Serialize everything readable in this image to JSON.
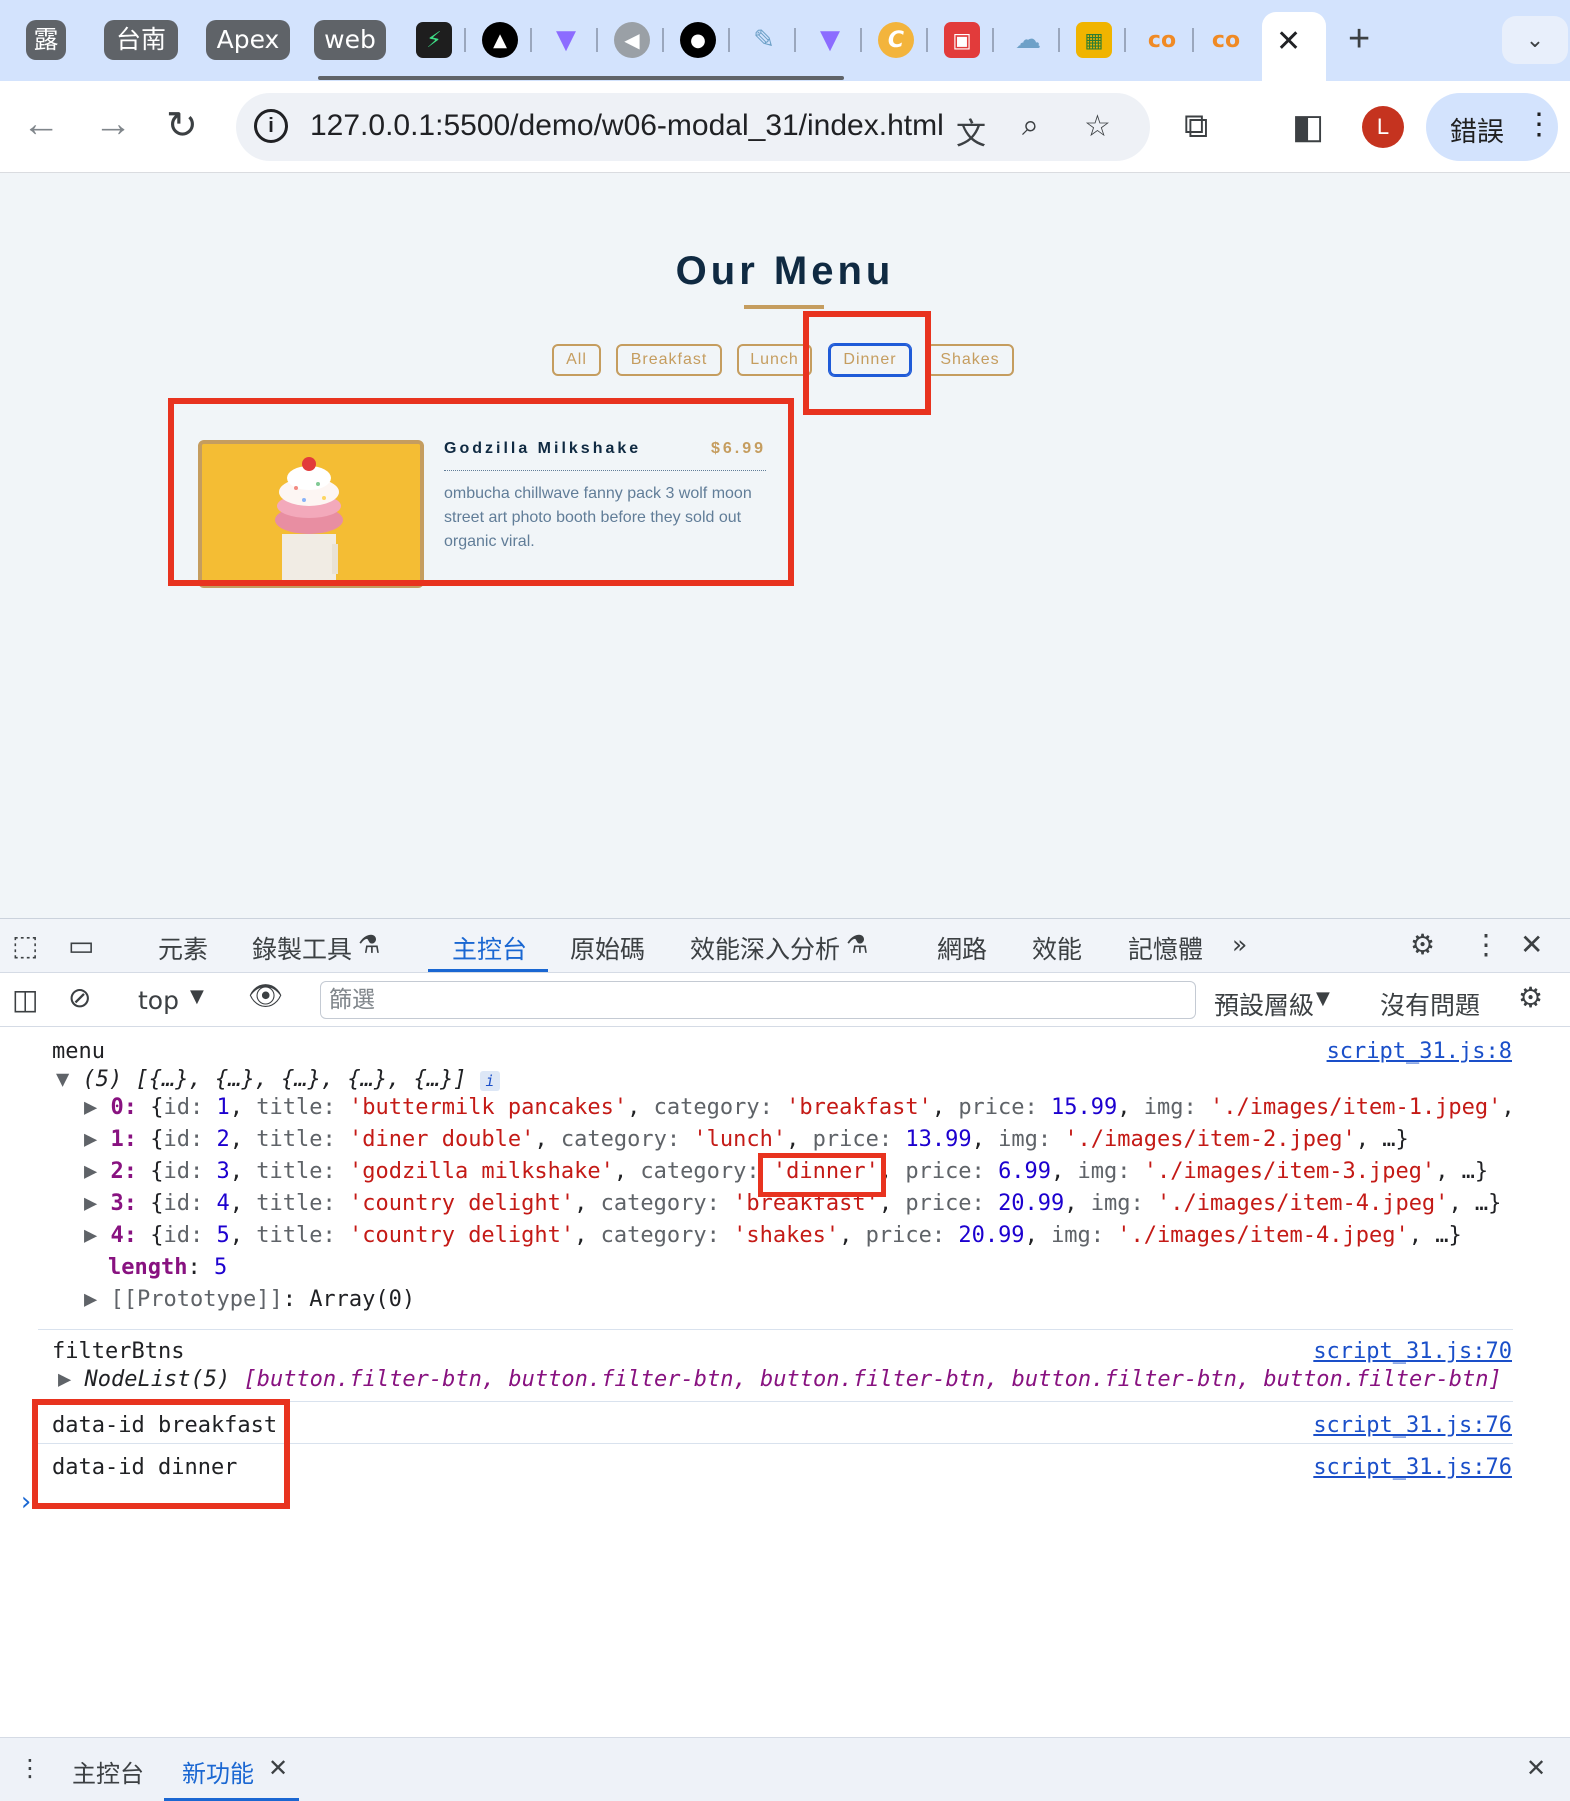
{
  "browser": {
    "pinned_tabs": [
      "露",
      "台南",
      "Apex",
      "web"
    ],
    "favicon_tabs": [
      {
        "icon": "bolt-icon",
        "bg": "#1e1e1e",
        "fg": "#3ddc84"
      },
      {
        "icon": "triangle-icon",
        "bg": "#000000",
        "fg": "#ffffff"
      },
      {
        "icon": "vite-icon",
        "bg": "#ffffff",
        "fg": "#8c6cff"
      },
      {
        "icon": "back-circle-icon",
        "bg": "#9aa0a6",
        "fg": "#ffffff"
      },
      {
        "icon": "github-icon",
        "bg": "#ffffff",
        "fg": "#000000"
      },
      {
        "icon": "pen-icon",
        "bg": "#ffffff",
        "fg": "#6ea1c8"
      },
      {
        "icon": "vite-icon",
        "bg": "#ffffff",
        "fg": "#8c6cff"
      },
      {
        "icon": "c-circle-icon",
        "bg": "#f3b43c",
        "fg": "#ffffff"
      },
      {
        "icon": "frame-icon",
        "bg": "#e23b3b",
        "fg": "#ffffff"
      },
      {
        "icon": "cloud-icon",
        "bg": "#ffffff",
        "fg": "#6ea1c8"
      },
      {
        "icon": "slides-icon",
        "bg": "#f0b400",
        "fg": "#2e7d32"
      },
      {
        "icon": "co-icon",
        "bg": "transparent",
        "fg": "#f08a24"
      },
      {
        "icon": "co-icon",
        "bg": "transparent",
        "fg": "#f08a24"
      }
    ],
    "active_tab_close": "✕",
    "new_tab": "+",
    "url": "127.0.0.1:5500/demo/w06-modal_31/index.html",
    "avatar_letter": "L",
    "error_button_label": "錯誤"
  },
  "page": {
    "title": "Our Menu",
    "filter_buttons": [
      "All",
      "Breakfast",
      "Lunch",
      "Dinner",
      "Shakes"
    ],
    "item": {
      "title": "Godzilla Milkshake",
      "price": "$6.99",
      "description": "ombucha chillwave fanny pack 3 wolf moon street art photo booth before they sold out organic viral."
    },
    "colors": {
      "accent": "#c59d5f",
      "heading": "#102a42",
      "annotation": "#e8331f"
    }
  },
  "devtools": {
    "tabs": [
      "元素",
      "錄製工具",
      "主控台",
      "原始碼",
      "效能深入分析",
      "網路",
      "效能",
      "記憶體"
    ],
    "context": "top",
    "filter_placeholder": "篩選",
    "levels": "預設層級",
    "issues": "沒有問題",
    "console": {
      "menu_label": "menu",
      "menu_src": "script_31.js:8",
      "array_summary": "(5) [{…}, {…}, {…}, {…}, {…}]",
      "items": [
        {
          "idx": "0",
          "id": "1",
          "title": "'buttermilk pancakes'",
          "category": "'breakfast'",
          "price": "15.99",
          "img": "'./images/item-1.jpeg'",
          "tail": ","
        },
        {
          "idx": "1",
          "id": "2",
          "title": "'diner double'",
          "category": "'lunch'",
          "price": "13.99",
          "img": "'./images/item-2.jpeg'",
          "tail": ", …}"
        },
        {
          "idx": "2",
          "id": "3",
          "title": "'godzilla milkshake'",
          "category": "'dinner'",
          "price": "6.99",
          "img": "'./images/item-3.jpeg'",
          "tail": ", …}"
        },
        {
          "idx": "3",
          "id": "4",
          "title": "'country delight'",
          "category": "'breakfast'",
          "price": "20.99",
          "img": "'./images/item-4.jpeg'",
          "tail": ", …}"
        },
        {
          "idx": "4",
          "id": "5",
          "title": "'country delight'",
          "category": "'shakes'",
          "price": "20.99",
          "img": "'./images/item-4.jpeg'",
          "tail": ", …}"
        }
      ],
      "length_label": "length",
      "length_value": "5",
      "prototype": "[[Prototype]]",
      "prototype_value": "Array(0)",
      "filterbtns_label": "filterBtns",
      "filterbtns_src": "script_31.js:70",
      "nodelist_prefix": "NodeList(5)",
      "nodelist_body": "[button.filter-btn, button.filter-btn, button.filter-btn, button.filter-btn, button.filter-btn]",
      "log_lines": [
        {
          "text": "data-id breakfast",
          "src": "script_31.js:76"
        },
        {
          "text": "data-id dinner",
          "src": "script_31.js:76"
        }
      ],
      "prompt": "›"
    },
    "drawer_tabs": [
      "主控台",
      "新功能"
    ]
  }
}
